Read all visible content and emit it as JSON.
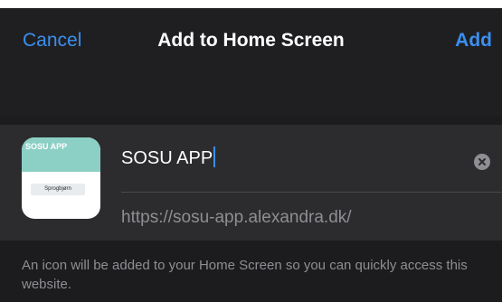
{
  "nav": {
    "cancel_label": "Cancel",
    "title": "Add to Home Screen",
    "add_label": "Add"
  },
  "app_icon": {
    "header_label": "SOSU APP",
    "pill_label": "Sprogbjørn"
  },
  "name_field": {
    "value": "SOSU APP"
  },
  "url": {
    "value": "https://sosu-app.alexandra.dk/"
  },
  "footer": {
    "text": "An icon will be added to your Home Screen so you can quickly access this website."
  },
  "colors": {
    "accent": "#3a8ff0",
    "background": "#1c1c1e",
    "card": "#2c2c2e",
    "secondary_text": "#8e8e93"
  },
  "icons": {
    "clear": "clear-circle-x-icon"
  }
}
